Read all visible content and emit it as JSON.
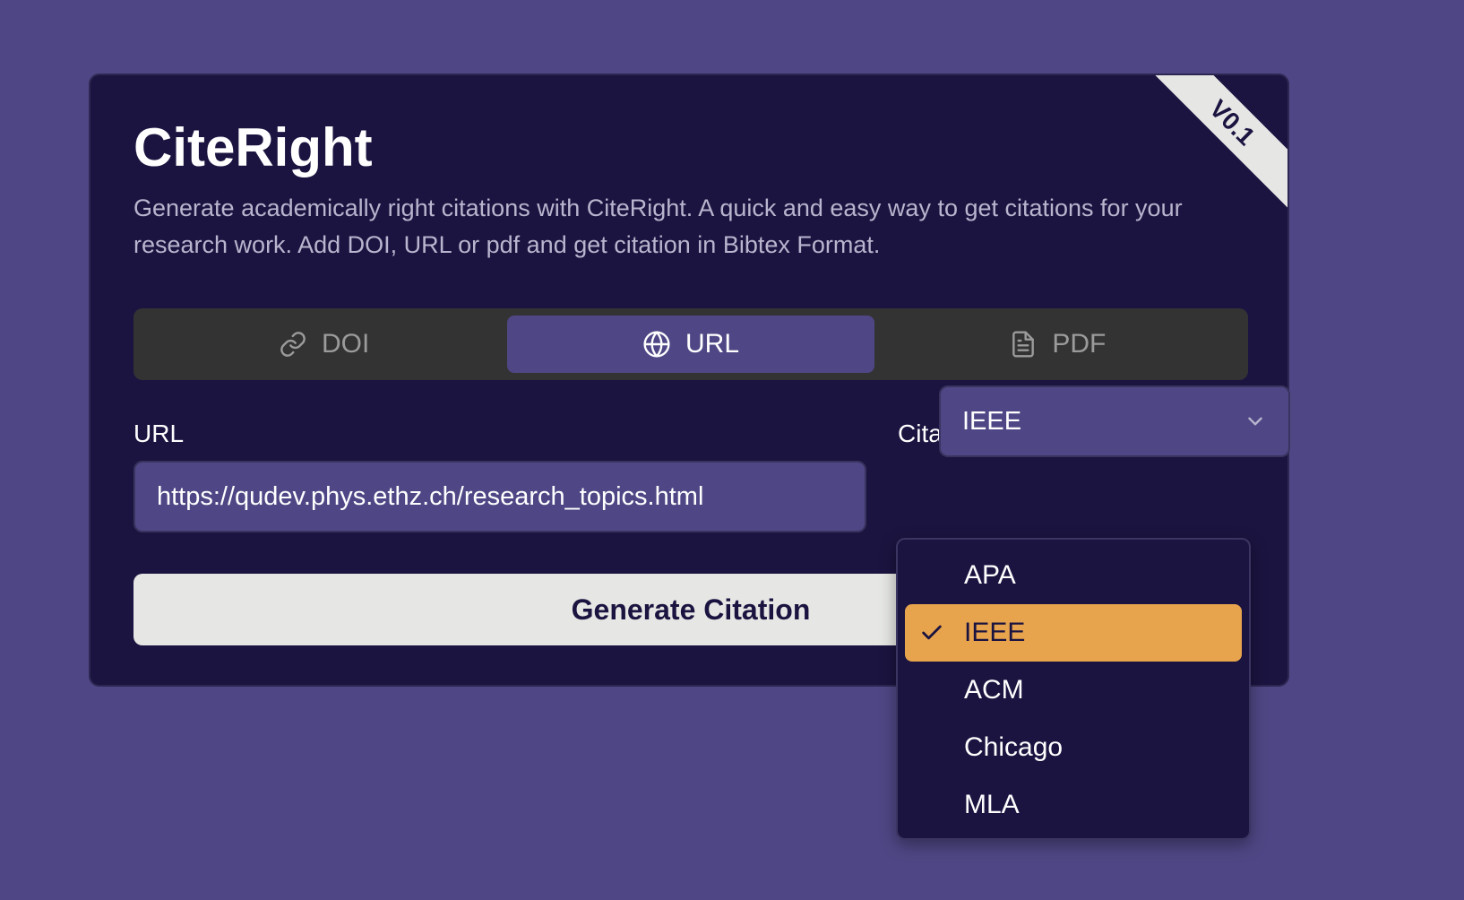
{
  "app": {
    "title": "CiteRight",
    "version": "V0.1",
    "description": "Generate academically right citations with CiteRight. A quick and easy way to get citations for your research work. Add DOI, URL or pdf and get citation in Bibtex Format."
  },
  "tabs": [
    {
      "label": "DOI",
      "icon": "link-icon",
      "active": false
    },
    {
      "label": "URL",
      "icon": "globe-icon",
      "active": true
    },
    {
      "label": "PDF",
      "icon": "file-icon",
      "active": false
    }
  ],
  "form": {
    "url_label": "URL",
    "url_value": "https://qudev.phys.ethz.ch/research_topics.html",
    "style_label": "Citation Style",
    "style_value": "IEEE",
    "generate_label": "Generate Citation"
  },
  "dropdown": {
    "options": [
      "APA",
      "IEEE",
      "ACM",
      "Chicago",
      "MLA"
    ],
    "selected": "IEEE"
  },
  "colors": {
    "background": "#4f4785",
    "card": "#1b1440",
    "accent": "#e8a44d",
    "tab_bar": "#333333",
    "button": "#e6e7e5"
  }
}
